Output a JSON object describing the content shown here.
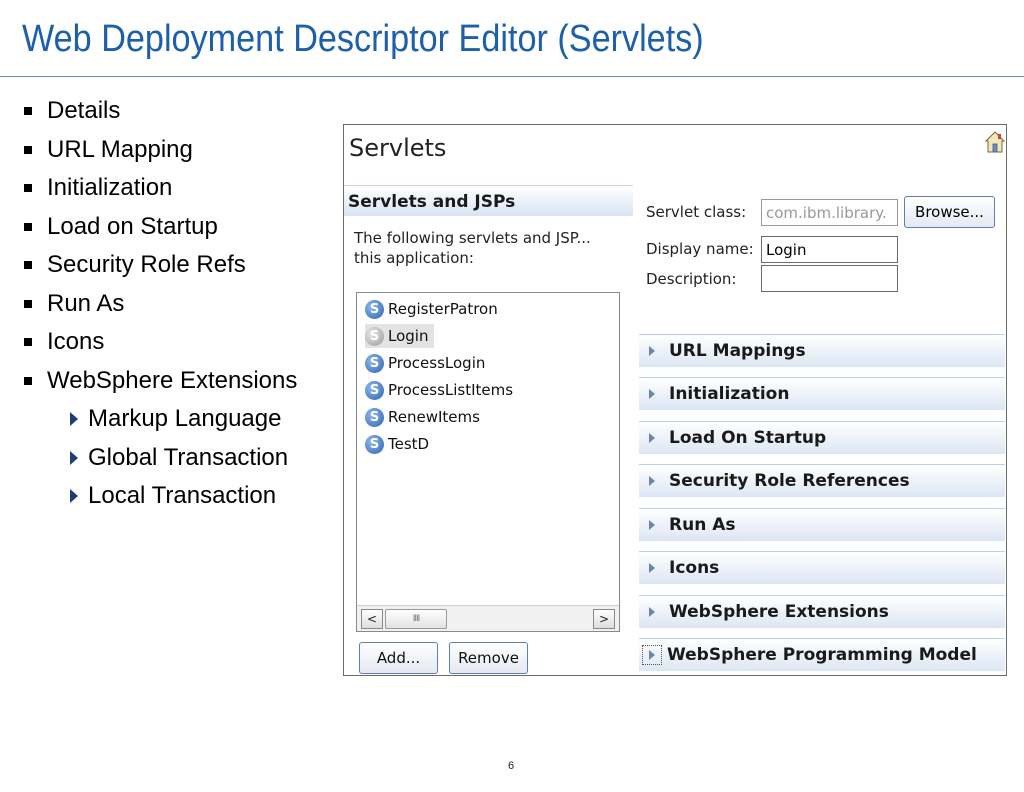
{
  "slide": {
    "title": "Web Deployment Descriptor Editor (Servlets)",
    "bullets": [
      "Details",
      "URL Mapping",
      "Initialization",
      "Load on Startup",
      "Security Role Refs",
      "Run As",
      "Icons",
      "WebSphere Extensions"
    ],
    "sub_bullets": [
      "Markup Language",
      "Global Transaction",
      "Local Transaction"
    ],
    "page_number": "6"
  },
  "editor": {
    "title": "Servlets",
    "section_title": "Servlets and JSPs",
    "description": "The following servlets and JSP...\nthis application:",
    "servlets": [
      "RegisterPatron",
      "Login",
      "ProcessLogin",
      "ProcessListItems",
      "RenewItems",
      "TestD"
    ],
    "selected_servlet": "Login",
    "scroll_left": "<",
    "scroll_right": ">",
    "scroll_thumb": "IIII",
    "add_label": "Add...",
    "remove_label": "Remove",
    "servlet_class_label": "Servlet class:",
    "servlet_class_value": "com.ibm.library.",
    "browse_label": "Browse...",
    "display_name_label": "Display name:",
    "display_name_value": "Login",
    "description_label": "Description:",
    "description_value": "",
    "sections": [
      "URL Mappings",
      "Initialization",
      "Load On Startup",
      "Security Role References",
      "Run As",
      "Icons",
      "WebSphere Extensions",
      "WebSphere Programming Model"
    ],
    "accent_color": "#1d5fa8",
    "icons": {
      "home": "home-icon",
      "servlet": "servlet-icon"
    }
  }
}
